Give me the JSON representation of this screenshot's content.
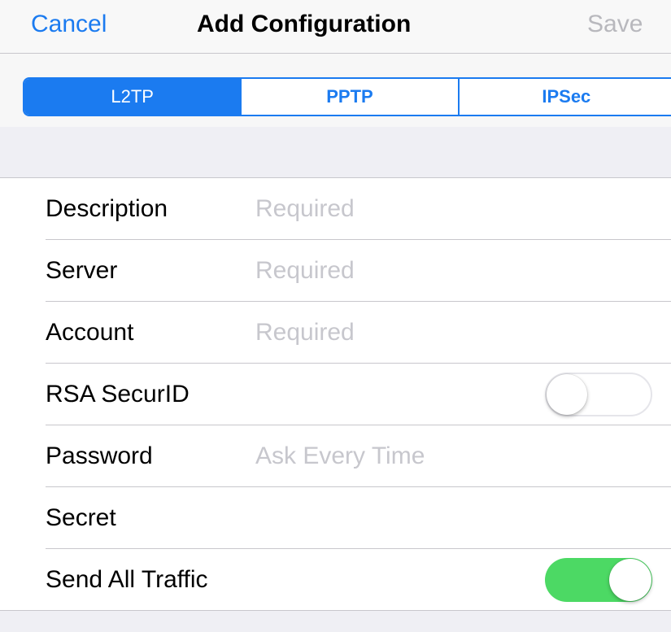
{
  "navbar": {
    "cancel_label": "Cancel",
    "title": "Add Configuration",
    "save_label": "Save"
  },
  "segments": [
    "L2TP",
    "PPTP",
    "IPSec"
  ],
  "selected_segment": "L2TP",
  "form": {
    "description": {
      "label": "Description",
      "placeholder": "Required"
    },
    "server": {
      "label": "Server",
      "placeholder": "Required"
    },
    "account": {
      "label": "Account",
      "placeholder": "Required"
    },
    "rsa": {
      "label": "RSA SecurID",
      "enabled": false
    },
    "password": {
      "label": "Password",
      "placeholder": "Ask Every Time"
    },
    "secret": {
      "label": "Secret"
    },
    "send_all_traffic": {
      "label": "Send All Traffic",
      "enabled": true
    }
  },
  "colors": {
    "accent": "#1b7bf0",
    "toggle_on": "#4cd964",
    "placeholder": "#c7c7cd",
    "background": "#efeff4"
  }
}
